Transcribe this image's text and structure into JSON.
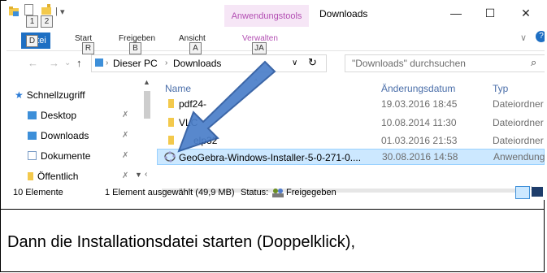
{
  "quick_access": {
    "badge_1": "1",
    "badge_2": "2"
  },
  "window": {
    "context_tab": "Anwendungstools",
    "title": "Downloads",
    "controls": {
      "minimize": "—",
      "maximize": "☐",
      "close": "✕"
    }
  },
  "ribbon": {
    "tabs": [
      {
        "label": "Datei",
        "key": "D"
      },
      {
        "label": "Start",
        "key": "R"
      },
      {
        "label": "Freigeben",
        "key": "B"
      },
      {
        "label": "Ansicht",
        "key": "A"
      },
      {
        "label": "Verwalten",
        "key": "JA"
      }
    ],
    "expand_icon": "∨",
    "help_icon": "?"
  },
  "address_bar": {
    "back": "←",
    "forward": "→",
    "recent": "⌄",
    "up": "↑",
    "path": [
      "Dieser PC",
      "Downloads"
    ],
    "dropdown": "∨",
    "refresh": "↻",
    "search_placeholder": "\"Downloads\" durchsuchen",
    "search_icon": "⌕"
  },
  "nav_pane": {
    "items": [
      {
        "label": "Schnellzugriff",
        "icon": "star-icon",
        "color": "#2b7bd6"
      },
      {
        "label": "Desktop",
        "icon": "desktop-folder-icon",
        "color": "#3d8fd9",
        "pinned": true
      },
      {
        "label": "Downloads",
        "icon": "downloads-folder-icon",
        "color": "#3d8fd9",
        "pinned": true
      },
      {
        "label": "Dokumente",
        "icon": "documents-folder-icon",
        "color": "#7a9cc6",
        "pinned": true
      },
      {
        "label": "Öffentlich",
        "icon": "folder-icon",
        "color": "#f3c94c",
        "pinned": true
      }
    ],
    "pin_glyph": "✗"
  },
  "file_list": {
    "columns": {
      "name": "Name",
      "date": "Änderungsdatum",
      "type": "Typ"
    },
    "rows": [
      {
        "name": "pdf24-",
        "date": "19.03.2016 18:45",
        "type": "Dateiordner",
        "selected": false
      },
      {
        "name": "VLC",
        "date": "10.08.2014 11:30",
        "type": "Dateiordner",
        "selected": false
      },
      {
        "name": "elp32",
        "date": "01.03.2016 21:53",
        "type": "Dateiordner",
        "selected": false
      },
      {
        "name": "GeoGebra-Windows-Installer-5-0-271-0....",
        "date": "30.08.2016 14:58",
        "type": "Anwendung",
        "selected": true
      }
    ]
  },
  "status_bar": {
    "count": "10 Elemente",
    "selection": "1 Element ausgewählt (49,9 MB)",
    "status_label": "Status:",
    "status_value": "Freigegeben"
  },
  "caption": "Dann die Installationsdatei starten (Doppelklick),",
  "colors": {
    "accent": "#1e6fc3",
    "arrow": "#4a7ec9",
    "selection": "#cce8ff",
    "context": "#b34fb3"
  }
}
